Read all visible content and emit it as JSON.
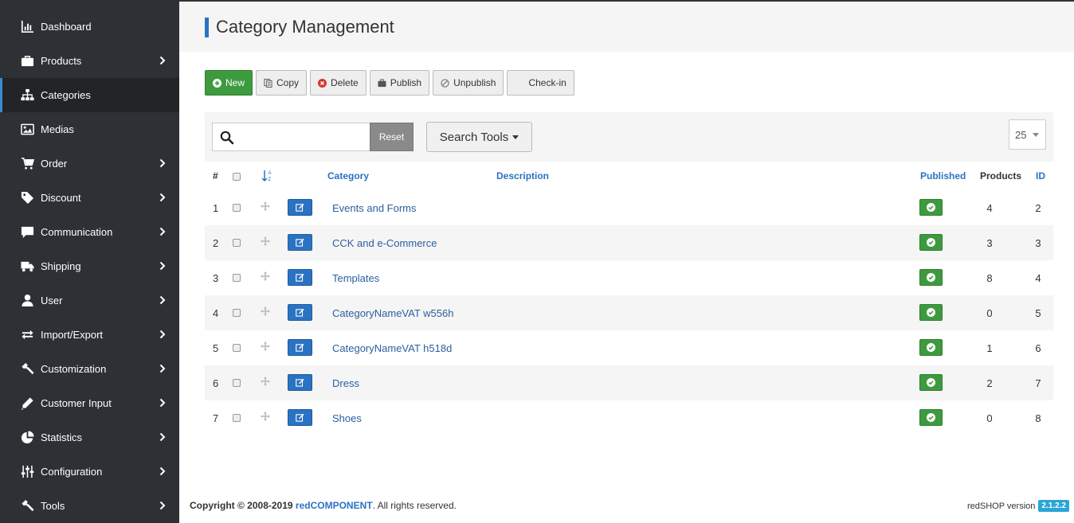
{
  "sidebar": {
    "items": [
      {
        "label": "Dashboard",
        "icon": "dashboard-icon",
        "chevron": false,
        "active": false
      },
      {
        "label": "Products",
        "icon": "briefcase-icon",
        "chevron": true,
        "active": false
      },
      {
        "label": "Categories",
        "icon": "sitemap-icon",
        "chevron": false,
        "active": true
      },
      {
        "label": "Medias",
        "icon": "image-icon",
        "chevron": false,
        "active": false
      },
      {
        "label": "Order",
        "icon": "cart-icon",
        "chevron": true,
        "active": false
      },
      {
        "label": "Discount",
        "icon": "tag-icon",
        "chevron": true,
        "active": false
      },
      {
        "label": "Communication",
        "icon": "comment-icon",
        "chevron": true,
        "active": false
      },
      {
        "label": "Shipping",
        "icon": "truck-icon",
        "chevron": true,
        "active": false
      },
      {
        "label": "User",
        "icon": "user-icon",
        "chevron": true,
        "active": false
      },
      {
        "label": "Import/Export",
        "icon": "exchange-icon",
        "chevron": true,
        "active": false
      },
      {
        "label": "Customization",
        "icon": "hammer-icon",
        "chevron": true,
        "active": false
      },
      {
        "label": "Customer Input",
        "icon": "pencil-icon",
        "chevron": true,
        "active": false
      },
      {
        "label": "Statistics",
        "icon": "pie-chart-icon",
        "chevron": true,
        "active": false
      },
      {
        "label": "Configuration",
        "icon": "sliders-icon",
        "chevron": true,
        "active": false
      },
      {
        "label": "Tools",
        "icon": "hammer-icon",
        "chevron": true,
        "active": false
      }
    ]
  },
  "header": {
    "title": "Category Management"
  },
  "toolbar": {
    "new_label": "New",
    "copy_label": "Copy",
    "delete_label": "Delete",
    "publish_label": "Publish",
    "unpublish_label": "Unpublish",
    "checkin_label": "Check-in"
  },
  "filters": {
    "search_value": "",
    "reset_label": "Reset",
    "search_tools_label": "Search Tools",
    "limit_value": "25"
  },
  "table": {
    "columns": {
      "num": "#",
      "category": "Category",
      "description": "Description",
      "published": "Published",
      "products": "Products",
      "id": "ID"
    },
    "rows": [
      {
        "num": "1",
        "category": "Events and Forms",
        "products": "4",
        "id": "2"
      },
      {
        "num": "2",
        "category": "CCK and e-Commerce",
        "products": "3",
        "id": "3"
      },
      {
        "num": "3",
        "category": "Templates",
        "products": "8",
        "id": "4"
      },
      {
        "num": "4",
        "category": "CategoryNameVAT w556h",
        "products": "0",
        "id": "5"
      },
      {
        "num": "5",
        "category": "CategoryNameVAT h518d",
        "products": "1",
        "id": "6"
      },
      {
        "num": "6",
        "category": "Dress",
        "products": "2",
        "id": "7"
      },
      {
        "num": "7",
        "category": "Shoes",
        "products": "0",
        "id": "8"
      }
    ]
  },
  "footer": {
    "copyright_prefix": "Copyright © 2008-2019",
    "brand": "redCOMPONENT",
    "copyright_suffix": ". All rights reserved.",
    "version_label": "redSHOP version",
    "version": "2.1.2.2"
  },
  "colors": {
    "sidebar_bg": "#2d3035",
    "accent": "#2b73c2",
    "success": "#3e9a3e"
  }
}
